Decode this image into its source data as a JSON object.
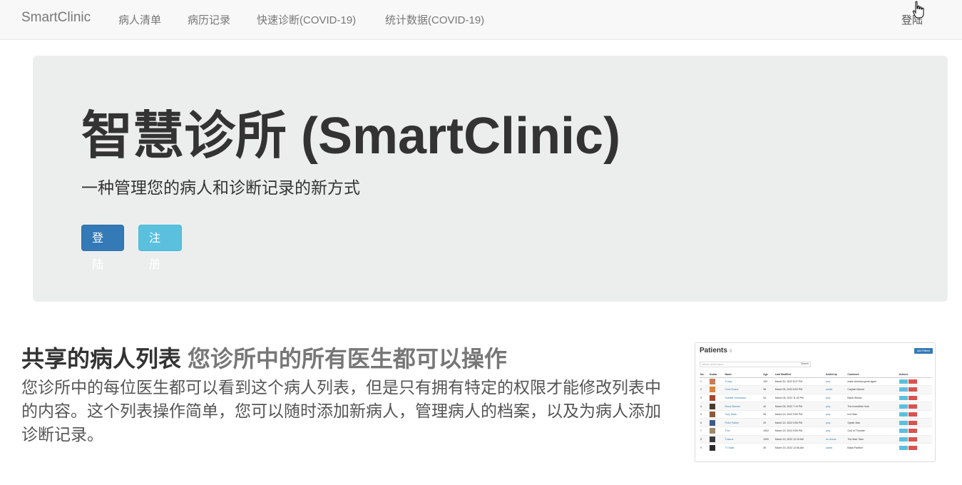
{
  "navbar": {
    "brand": "SmartClinic",
    "links": [
      "病人清单",
      "病历记录",
      "快速诊断(COVID-19)",
      "统计数据(COVID-19)"
    ],
    "login": "登陆"
  },
  "jumbotron": {
    "title": "智慧诊所 (SmartClinic)",
    "subtitle": "一种管理您的病人和诊断记录的新方式",
    "login_button": "登陆",
    "register_button": "注册"
  },
  "feature": {
    "heading": "共享的病人列表",
    "heading_muted": "您诊所中的所有医生都可以操作",
    "text": "您诊所中的每位医生都可以看到这个病人列表，但是只有拥有特定的权限才能修改列表中的内容。这个列表操作简单，您可以随时添加新病人，管理病人的档案，以及为病人添加诊断记录。"
  },
  "thumbnail": {
    "title": "Patients",
    "count": "9",
    "add_button": "Add Patient",
    "search_placeholder": "please select name...",
    "search_label": "Search",
    "columns": [
      "No.",
      "Avatar",
      "Name",
      "Age",
      "Last Modified",
      "Added by",
      "Comment",
      "Actions"
    ],
    "rows": [
      {
        "no": "1",
        "name": "Trump",
        "age": "100",
        "modified": "March 30, 2022 8:37 PM",
        "added_by": "joey",
        "comment": "make America great again",
        "avatar": "#c97d58"
      },
      {
        "no": "2",
        "name": "Chris Evans",
        "age": "38",
        "modified": "March 05, 2022 8:52 PM",
        "added_by": "austin",
        "comment": "Captain Marvel",
        "avatar": "#d8823e"
      },
      {
        "no": "3",
        "name": "Scarlett Johansson",
        "age": "34",
        "modified": "March 05, 2022 11:43 PM",
        "added_by": "joey",
        "comment": "Black Widow",
        "avatar": "#a3472e"
      },
      {
        "no": "4",
        "name": "Bruce Banner",
        "age": "40",
        "modified": "March 05, 2022 7:19 PM",
        "added_by": "joey",
        "comment": "The Incredible Hulk",
        "avatar": "#4a3a2e"
      },
      {
        "no": "5",
        "name": "Tony Stark",
        "age": "38",
        "modified": "March 19, 2022 5:50 PM",
        "added_by": "joey",
        "comment": "Iron Man",
        "avatar": "#8b5a3a"
      },
      {
        "no": "6",
        "name": "Peter Parker",
        "age": "20",
        "modified": "March 19, 2022 5:55 PM",
        "added_by": "joey",
        "comment": "Spider Man",
        "avatar": "#3d5c88"
      },
      {
        "no": "7",
        "name": "Thor",
        "age": "1002",
        "modified": "March 19, 2022 5:59 PM",
        "added_by": "joey",
        "comment": "God of Thunder",
        "avatar": "#9c8a6a"
      },
      {
        "no": "8",
        "name": "Thanos",
        "age": "1000",
        "modified": "March 19, 2022 12:15 AM",
        "added_by": "no-doctor",
        "comment": "The Mad Titan",
        "avatar": "#3a3a3a"
      },
      {
        "no": "9",
        "name": "T'Challa",
        "age": "35",
        "modified": "March 19, 2022 12:06 AM",
        "added_by": "austin",
        "comment": "Black Panther",
        "avatar": "#2b2b2b"
      }
    ],
    "edit_label": "Edit",
    "delete_label": "Delete"
  },
  "colors": {
    "primary": "#337ab7",
    "info": "#5bc0de",
    "danger": "#d9534f",
    "jumbotron_bg": "#eceeee",
    "navbar_bg": "#f8f8f8"
  }
}
